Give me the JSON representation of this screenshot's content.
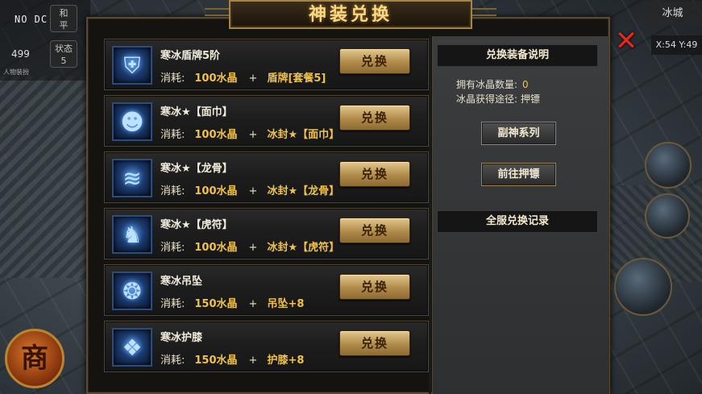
{
  "window": {
    "title": "神装兑换"
  },
  "hud": {
    "status_text": "NO DC",
    "btn_hp": "和\n平",
    "btn_status": "状态\n5",
    "count": "499",
    "count_sub": "人物装扮",
    "map_name": "冰城",
    "coords": "X:54 Y:49"
  },
  "shop_button": "商",
  "items": [
    {
      "name": "寒冰盾牌5阶",
      "icon": "shield-icon",
      "cost_label": "消耗:",
      "cost_amount": "100水晶",
      "plus": "+",
      "requirement": "盾牌[套餐5]",
      "button": "兑换"
    },
    {
      "name": "寒冰★【面巾】",
      "icon": "mask-icon",
      "cost_label": "消耗:",
      "cost_amount": "100水晶",
      "plus": "+",
      "requirement": "冰封★【面巾】",
      "button": "兑换"
    },
    {
      "name": "寒冰★【龙骨】",
      "icon": "dragon-bone-icon",
      "cost_label": "消耗:",
      "cost_amount": "100水晶",
      "plus": "+",
      "requirement": "冰封★【龙骨】",
      "button": "兑换"
    },
    {
      "name": "寒冰★【虎符】",
      "icon": "tiger-talisman-icon",
      "cost_label": "消耗:",
      "cost_amount": "100水晶",
      "plus": "+",
      "requirement": "冰封★【虎符】",
      "button": "兑换"
    },
    {
      "name": "寒冰吊坠",
      "icon": "pendant-icon",
      "cost_label": "消耗:",
      "cost_amount": "150水晶",
      "plus": "+",
      "requirement": "吊坠+8",
      "button": "兑换"
    },
    {
      "name": "寒冰护膝",
      "icon": "kneepad-icon",
      "cost_label": "消耗:",
      "cost_amount": "150水晶",
      "plus": "+",
      "requirement": "护膝+8",
      "button": "兑换"
    }
  ],
  "panel": {
    "header": "兑换装备说明",
    "crystal_label": "拥有冰晶数量:",
    "crystal_value": "0",
    "source_label": "冰晶获得途径:",
    "source_value": "押镖",
    "btn_fushen": "副神系列",
    "btn_escort": "前往押镖",
    "history_header": "全服兑换记录"
  },
  "colors": {
    "accent_gold": "#f0c24a",
    "title_gold": "#f5d98a",
    "close_red": "#e02a1d",
    "frame_brown": "#5b4a2d"
  }
}
